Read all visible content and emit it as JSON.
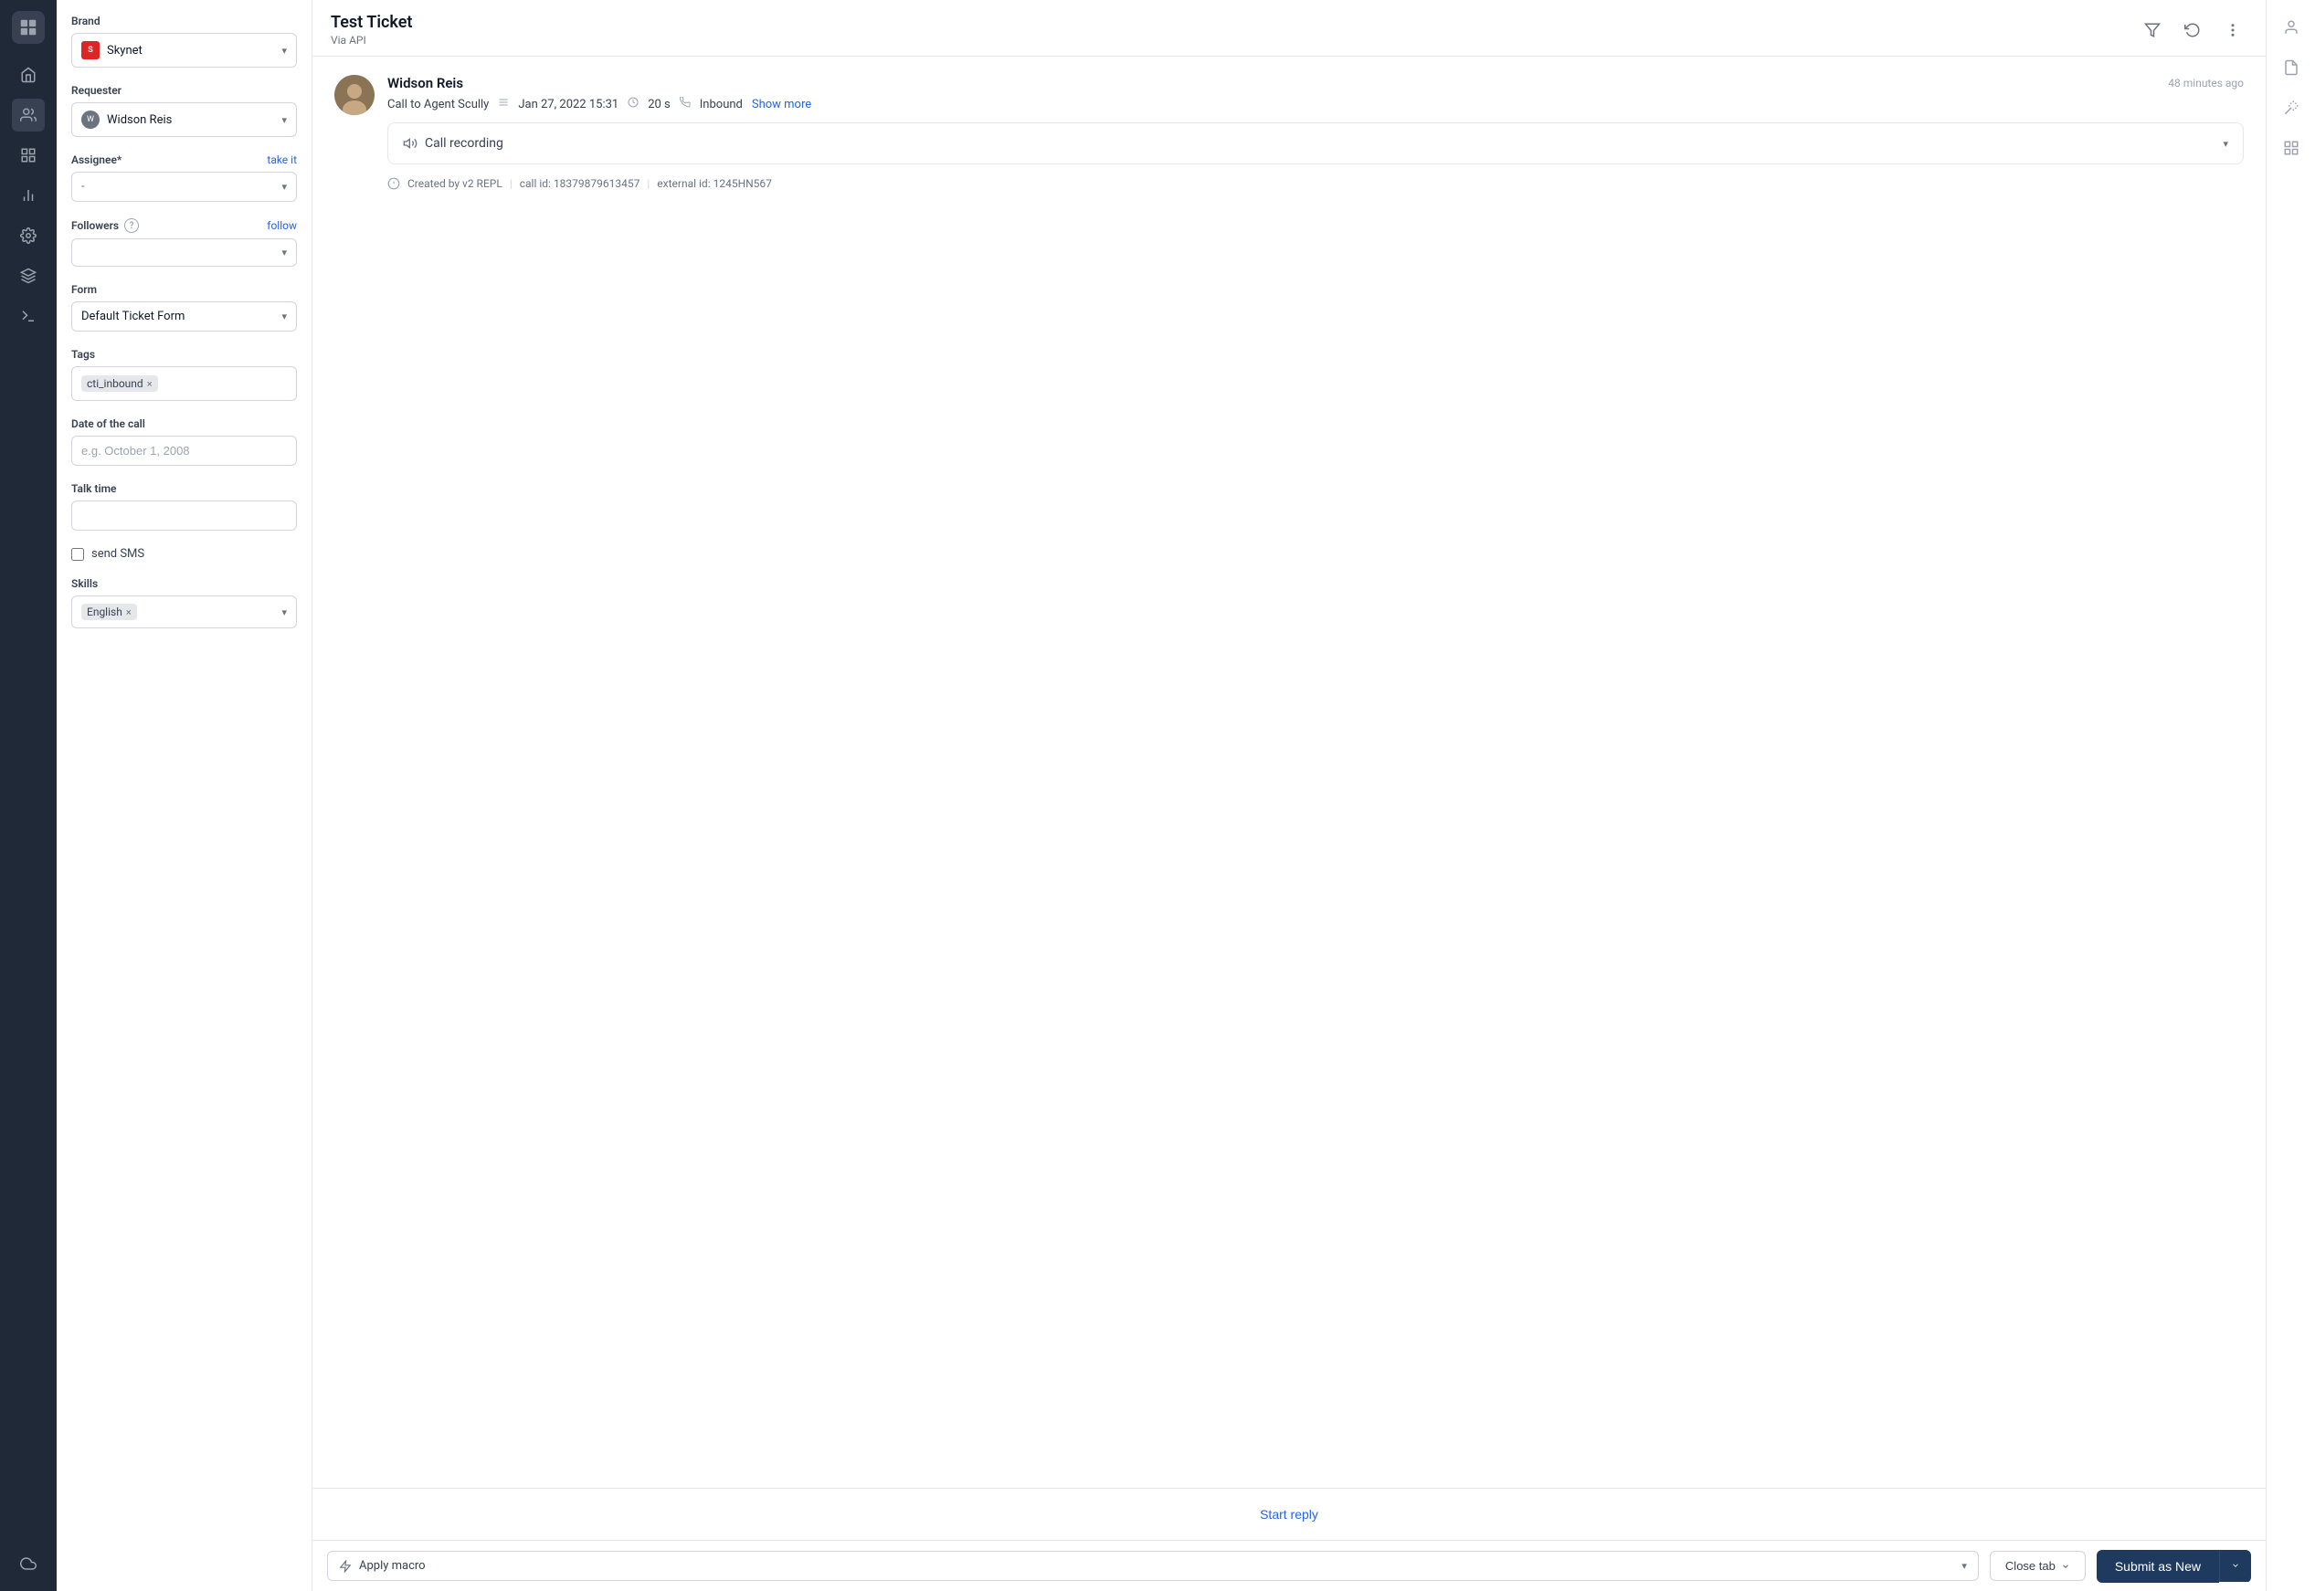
{
  "leftNav": {
    "icons": [
      {
        "name": "home-icon",
        "glyph": "⊞",
        "active": false
      },
      {
        "name": "users-icon",
        "glyph": "👤",
        "active": false
      },
      {
        "name": "grid-icon",
        "glyph": "▦",
        "active": false
      },
      {
        "name": "chart-icon",
        "glyph": "📊",
        "active": false
      },
      {
        "name": "settings-icon",
        "glyph": "⚙",
        "active": false
      },
      {
        "name": "puzzle-icon",
        "glyph": "✦",
        "active": false
      },
      {
        "name": "terminal-icon",
        "glyph": "⌨",
        "active": false
      },
      {
        "name": "cloud-icon",
        "glyph": "☁",
        "active": false
      }
    ]
  },
  "sidebar": {
    "brand": {
      "label": "Brand",
      "value": "Skynet",
      "iconText": "S"
    },
    "requester": {
      "label": "Requester",
      "value": "Widson Reis"
    },
    "assignee": {
      "label": "Assignee*",
      "action": "take it",
      "value": "-"
    },
    "followers": {
      "label": "Followers",
      "action": "follow"
    },
    "form": {
      "label": "Form",
      "value": "Default Ticket Form"
    },
    "tags": {
      "label": "Tags",
      "chips": [
        {
          "text": "cti_inbound"
        }
      ]
    },
    "dateOfCall": {
      "label": "Date of the call",
      "placeholder": "e.g. October 1, 2008"
    },
    "talkTime": {
      "label": "Talk time"
    },
    "sendSms": {
      "label": "send SMS"
    },
    "skills": {
      "label": "Skills",
      "chips": [
        {
          "text": "English"
        }
      ]
    }
  },
  "ticket": {
    "title": "Test Ticket",
    "subtitle": "Via API"
  },
  "message": {
    "sender": "Widson Reis",
    "time": "48 minutes ago",
    "callTo": "Call to Agent Scully",
    "date": "Jan 27, 2022 15:31",
    "duration": "20 s",
    "direction": "Inbound",
    "showMore": "Show more",
    "callRecording": "Call recording",
    "createdBy": "Created by v2 REPL",
    "callId": "call id: 18379879613457",
    "externalId": "external id: 1245HN567"
  },
  "replyArea": {
    "startReply": "Start reply"
  },
  "bottomBar": {
    "macroLabel": "Apply macro",
    "closeTab": "Close tab",
    "submitLabel": "Submit as New"
  },
  "rightPanel": {
    "icons": [
      {
        "name": "user-profile-icon",
        "glyph": "👤"
      },
      {
        "name": "document-icon",
        "glyph": "📄"
      },
      {
        "name": "magic-icon",
        "glyph": "✦"
      },
      {
        "name": "apps-icon",
        "glyph": "⊞"
      }
    ]
  }
}
